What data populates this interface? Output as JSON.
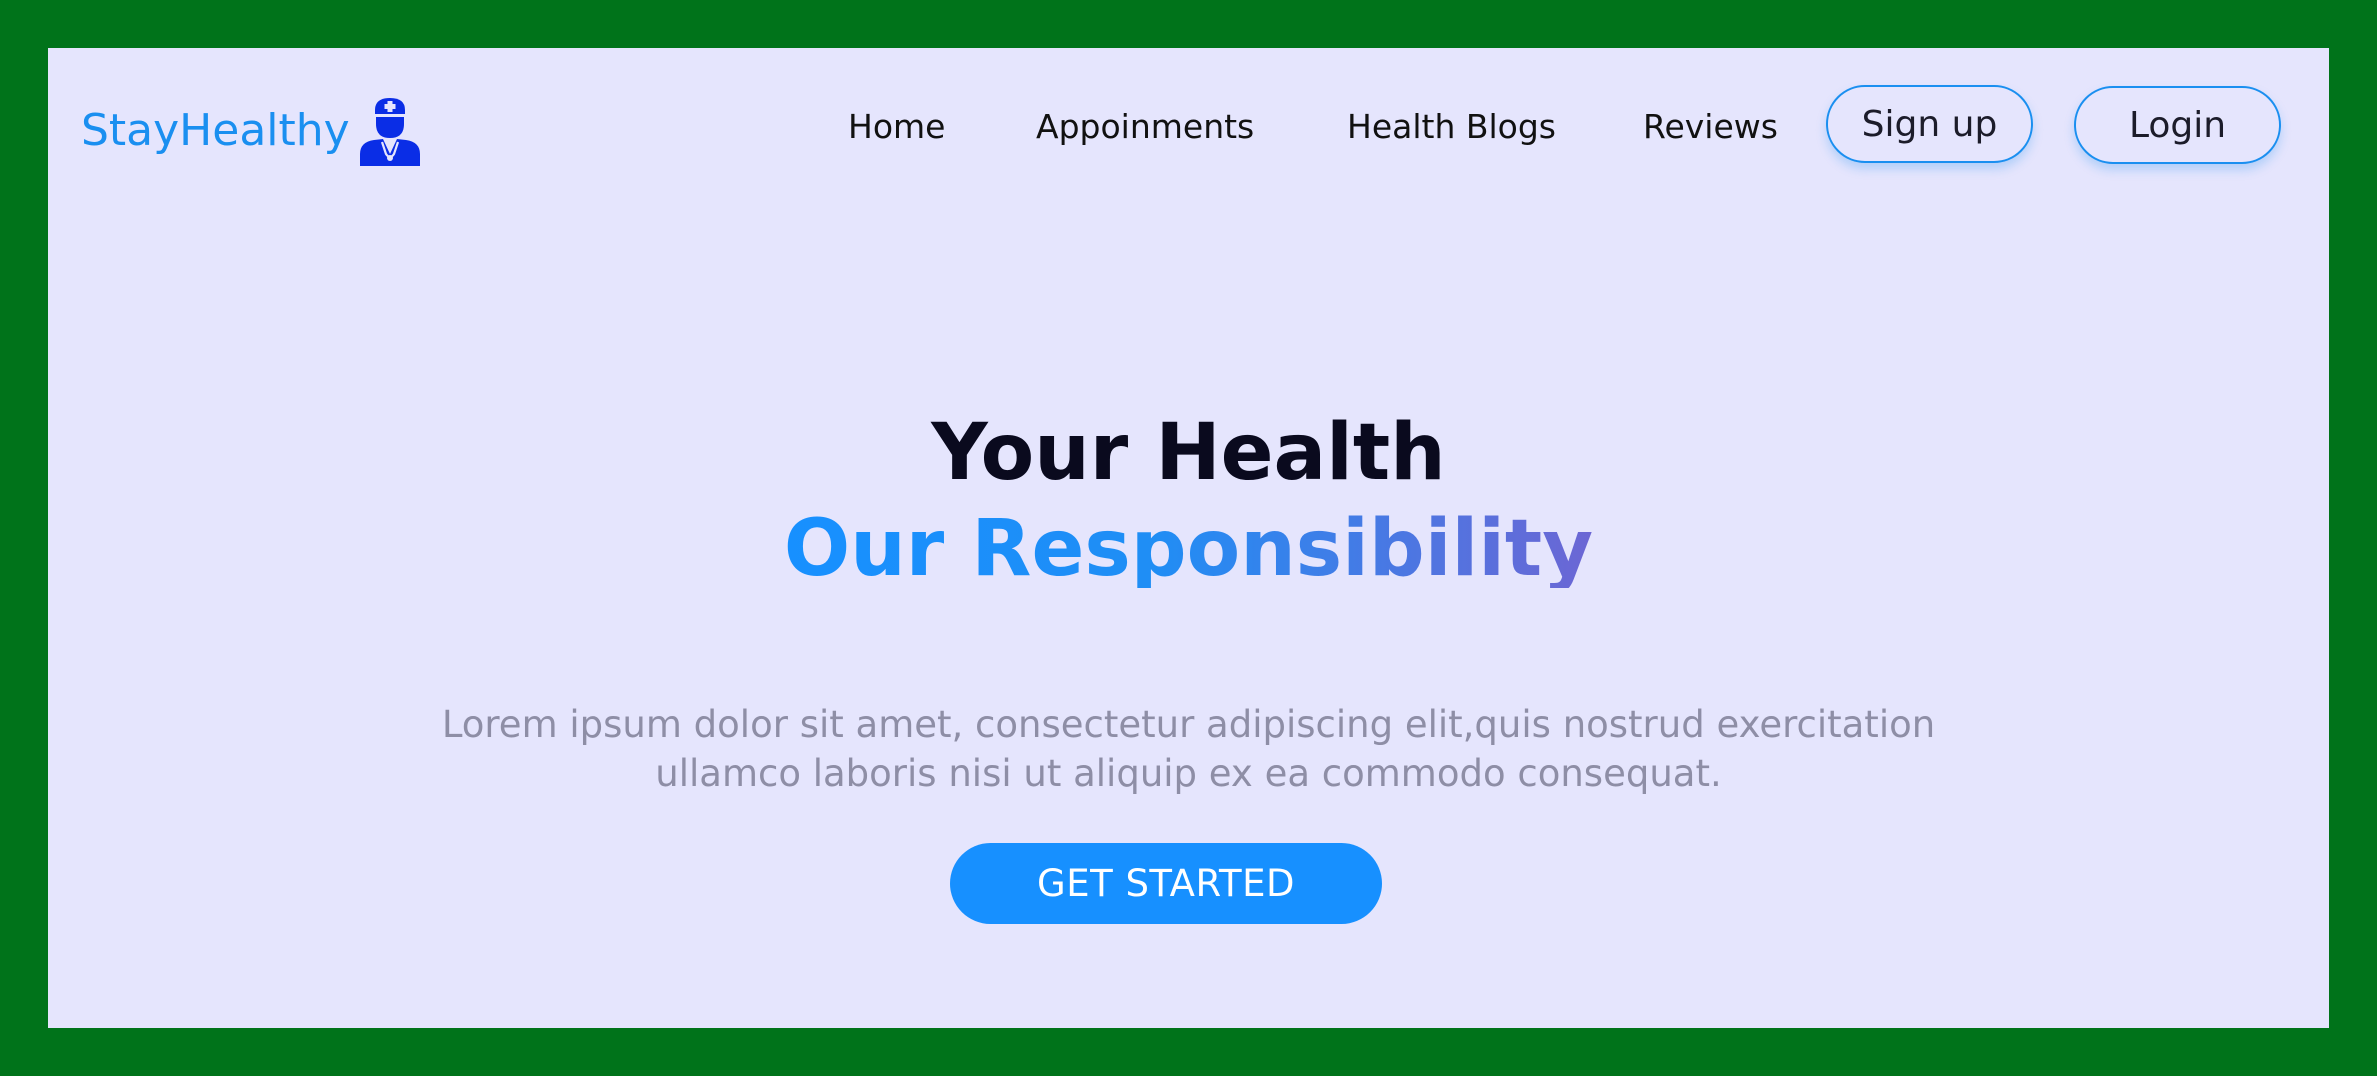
{
  "colors": {
    "frame_border": "#00731a",
    "panel_background": "#e5e5fd",
    "brand": "#1a8ff0",
    "brand_icon": "#0a2de6",
    "accent": "#1790ff",
    "accent_gradient_end": "#6c66d4",
    "nav_text": "#111111",
    "description_text": "#8e8ea6"
  },
  "header": {
    "brand_name": "StayHealthy",
    "brand_icon": "doctor-icon",
    "nav": [
      {
        "label": "Home"
      },
      {
        "label": "Appoinments"
      },
      {
        "label": "Health Blogs"
      },
      {
        "label": "Reviews"
      }
    ],
    "signup_label": "Sign up",
    "login_label": "Login"
  },
  "hero": {
    "title_line1": "Your Health",
    "title_line2": "Our Responsibility",
    "description_line1": "Lorem ipsum dolor sit amet, consectetur adipiscing elit,quis nostrud exercitation",
    "description_line2": "ullamco laboris nisi ut aliquip ex ea commodo consequat.",
    "cta_label": "GET STARTED"
  }
}
